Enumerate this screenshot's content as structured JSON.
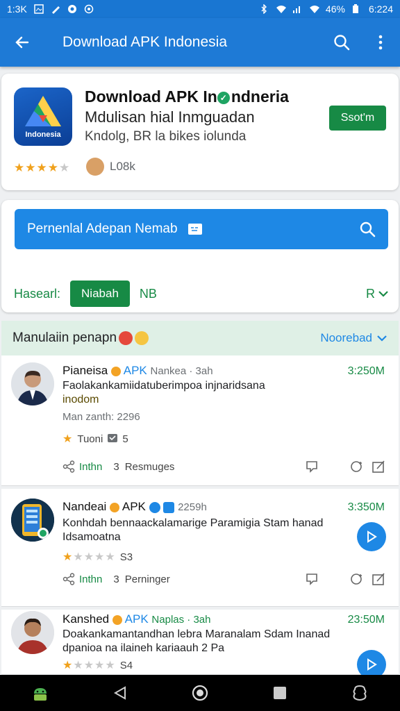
{
  "status_bar": {
    "time_left": "1:3K",
    "battery": "46%",
    "time_right": "6:224"
  },
  "app_bar": {
    "title": "Download APK Indonesia"
  },
  "app_card": {
    "title_main": "Download APK In",
    "title_rest": "ndneria",
    "subtitle": "Mdulisan hial Inmguadan",
    "subtitle2": "Kndolg, BR la bikes iolunda",
    "icon_label": "Indonesia",
    "install_label": "Ssot'm",
    "rating": 3.5,
    "downloads": "L08k"
  },
  "search": {
    "placeholder": "Pernenlal Adepan Nemab"
  },
  "filters": {
    "label": "Hasearl:",
    "active": "Niabah",
    "option": "NB",
    "sort": "R"
  },
  "section": {
    "title": "Manulaiin penapn",
    "more": "Noorebad"
  },
  "posts": [
    {
      "author": "Pianeisa",
      "brand": "APK",
      "meta": "Nankea · 3ah",
      "size": "3:250M",
      "text": "Faolakankamiidatuberimpoa injnaridsana",
      "text2": "inodom",
      "note": "Man zanth: 2296",
      "rating_label": "Tuoni",
      "rating_count": "5",
      "link": "Inthn",
      "reply_count": "3",
      "reply_label": "Resmuges"
    },
    {
      "author": "Nandeai",
      "brand": "APK",
      "meta": "2259h",
      "size": "3:350M",
      "text": "Konhdah bennaackalamarige Paramigia Stam hanad",
      "text2": "Idsamoatna",
      "stars": 1,
      "stars_count": "S3",
      "link": "Inthn",
      "reply_count": "3",
      "reply_label": "Perninger"
    },
    {
      "author": "Kanshed",
      "brand": "APK",
      "meta": "Naplas · 3ah",
      "size": "23:50M",
      "text": "Doakankamantandhan lebra Maranalam Sdam Inanad",
      "text2": "dpanioa na ilaineh kariaauh 2 Pa",
      "stars": 1,
      "stars_count": "S4"
    }
  ],
  "colors": {
    "primary": "#1e7ad6",
    "accent_green": "#178a45",
    "link_blue": "#1e88e5"
  }
}
